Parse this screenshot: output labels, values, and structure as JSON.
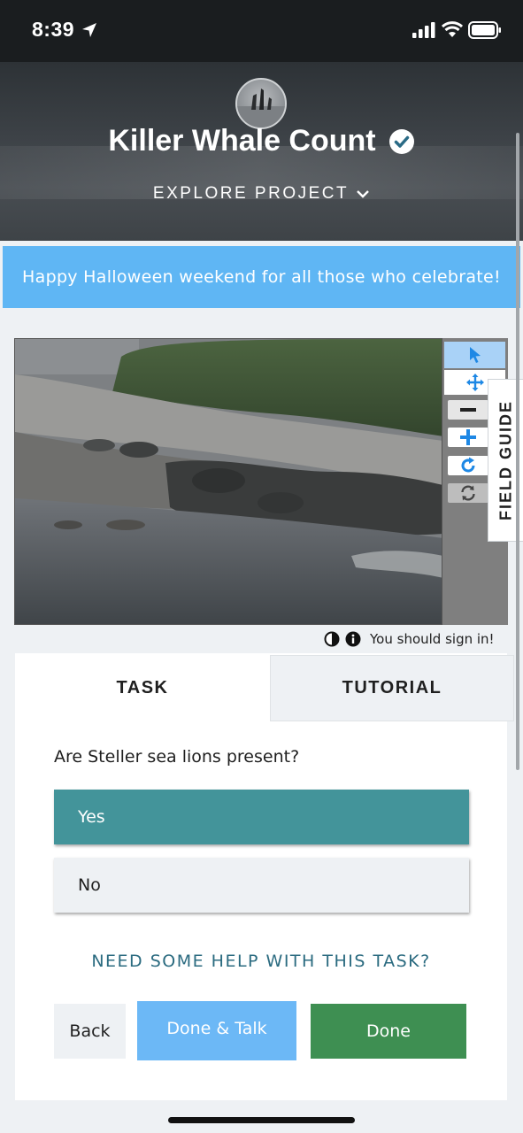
{
  "status_bar": {
    "time": "8:39"
  },
  "header": {
    "title": "Killer Whale Count",
    "explore_label": "EXPLORE PROJECT"
  },
  "announcement": {
    "text": "Happy Halloween weekend for all those who celebrate!"
  },
  "field_guide": {
    "label": "FIELD GUIDE"
  },
  "subject_meta": {
    "sign_in_text": "You should sign in!"
  },
  "tabs": {
    "task": "TASK",
    "tutorial": "TUTORIAL"
  },
  "task": {
    "question": "Are Steller sea lions present?",
    "answers": [
      "Yes",
      "No"
    ],
    "selected_answer": "Yes",
    "help_link": "NEED SOME HELP WITH THIS TASK?"
  },
  "buttons": {
    "back": "Back",
    "done_talk": "Done & Talk",
    "done": "Done"
  },
  "colors": {
    "banner": "#5fb6f4",
    "selected_answer": "#43949a",
    "done_talk": "#6cb8f6",
    "done": "#3e8f52",
    "tool_accent": "#1e88e5"
  }
}
